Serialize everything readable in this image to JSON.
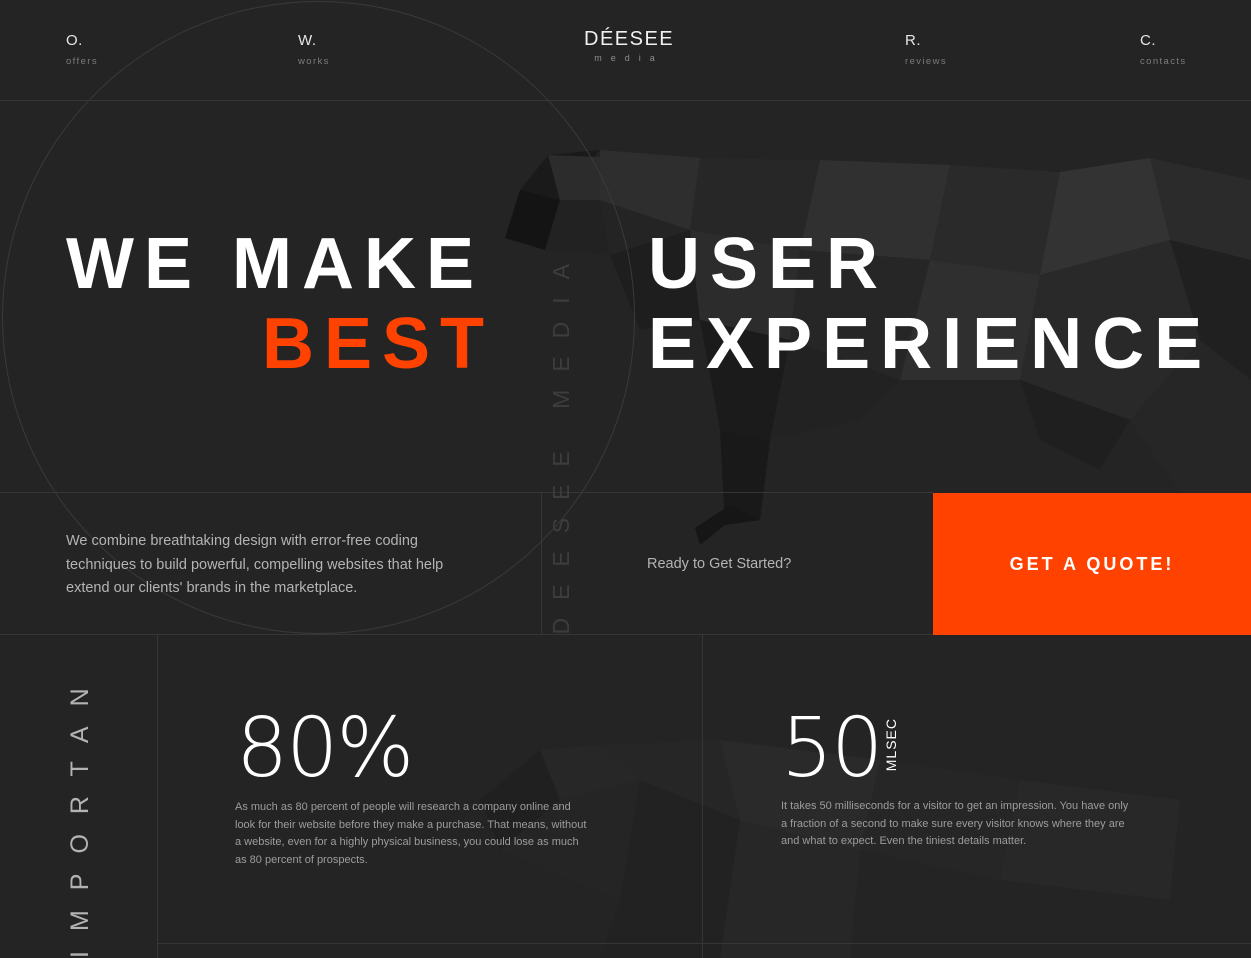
{
  "nav": {
    "items": [
      {
        "letter": "O.",
        "label": "offers"
      },
      {
        "letter": "W.",
        "label": "works"
      },
      {
        "letter": "R.",
        "label": "reviews"
      },
      {
        "letter": "C.",
        "label": "contacts"
      }
    ]
  },
  "logo": {
    "main": "DÉESEE",
    "sub": "media"
  },
  "hero": {
    "line1": "WE MAKE",
    "line2_accent": "BEST",
    "line3": "USER",
    "line4": "EXPERIENCE"
  },
  "vertical_brand": "DEESEE MEDIA",
  "intro": "We combine breathtaking design with error-free coding techniques to build powerful, compelling websites that help extend our clients' brands in the marketplace.",
  "cta": {
    "question": "Ready to Get Started?",
    "button_label": "GET A QUOTE!"
  },
  "facts": {
    "section_label": "IMPORTANT FACTS",
    "items": [
      {
        "value": "80%",
        "description": "As much as 80 percent of people will research a company online and look for their website before they make a purchase. That means, without a website, even for a highly physical business, you could lose as much as 80 percent of prospects."
      },
      {
        "value": "50",
        "unit": "MLSEC",
        "description": "It takes 50 milliseconds for a visitor to get an impression. You have only a fraction of a second to make sure every visitor knows where they are and what to expect. Even the tiniest details matter."
      }
    ]
  },
  "colors": {
    "background": "#242424",
    "accent": "#ff4200",
    "text": "#ffffff",
    "muted": "#b4b4b4",
    "lines": "#363636"
  }
}
